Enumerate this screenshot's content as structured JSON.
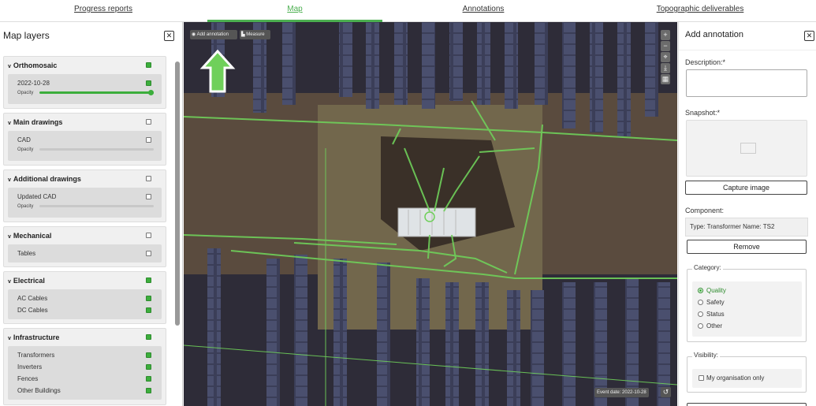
{
  "nav": {
    "tabs": [
      {
        "label": "Progress reports"
      },
      {
        "label": "Map"
      },
      {
        "label": "Annotations"
      },
      {
        "label": "Topographic deliverables"
      }
    ],
    "active_tab": "Map"
  },
  "layers_panel": {
    "title": "Map layers",
    "close_icon": "close-icon",
    "groups": [
      {
        "title": "Orthomosaic",
        "checked": true,
        "items": [
          {
            "label": "2022-10-28",
            "checked": true,
            "opacity_label": "Opacity",
            "opacity": 1.0
          }
        ]
      },
      {
        "title": "Main drawings",
        "checked": false,
        "items": [
          {
            "label": "CAD",
            "checked": false,
            "opacity_label": "Opacity",
            "opacity": 0
          }
        ]
      },
      {
        "title": "Additional drawings",
        "checked": false,
        "items": [
          {
            "label": "Updated CAD",
            "checked": false,
            "opacity_label": "Opacity",
            "opacity": 0
          }
        ]
      },
      {
        "title": "Mechanical",
        "checked": false,
        "items": [
          {
            "label": "Tables",
            "checked": false
          }
        ]
      },
      {
        "title": "Electrical",
        "checked": true,
        "items": [
          {
            "label": "AC Cables",
            "checked": true
          },
          {
            "label": "DC Cables",
            "checked": true
          }
        ]
      },
      {
        "title": "Infrastructure",
        "checked": true,
        "items": [
          {
            "label": "Transformers",
            "checked": true
          },
          {
            "label": "Inverters",
            "checked": true
          },
          {
            "label": "Fences",
            "checked": true
          },
          {
            "label": "Other Buildings",
            "checked": true
          }
        ]
      }
    ]
  },
  "map": {
    "add_annotation_label": "Add annotation",
    "measure_label": "Measure",
    "controls": [
      "zoom-in-icon",
      "zoom-out-icon",
      "fit-extent-icon",
      "download-icon",
      "grid-icon"
    ],
    "event_date": "Event date: 2022-10-28",
    "history_icon": "history-icon",
    "accent": "#6fd05a"
  },
  "annotation_panel": {
    "title": "Add annotation",
    "description_label": "Description:*",
    "snapshot_label": "Snapshot:*",
    "capture_button": "Capture image",
    "component_label": "Component:",
    "component_value": "Type:  Transformer  Name:  TS2",
    "remove_button": "Remove",
    "category_label": "Category:",
    "categories": [
      "Quality",
      "Safety",
      "Status",
      "Other"
    ],
    "selected_category": "Quality",
    "visibility_label": "Visibility:",
    "visibility_option": "My organisation only"
  }
}
